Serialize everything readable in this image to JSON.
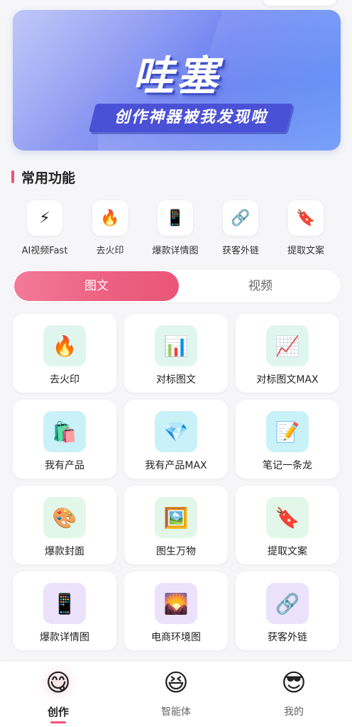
{
  "banner": {
    "title": "哇塞",
    "subtitle": "创作神器被我发现啦"
  },
  "section": {
    "title": "常用功能"
  },
  "quick_actions": [
    {
      "label": "AI视频Fast",
      "icon": "lightning-icon",
      "glyph": "⚡"
    },
    {
      "label": "去火印",
      "icon": "fire-icon",
      "glyph": "🔥"
    },
    {
      "label": "爆款详情图",
      "icon": "phone-icon",
      "glyph": "📱"
    },
    {
      "label": "获客外链",
      "icon": "link-icon",
      "glyph": "🔗"
    },
    {
      "label": "提取文案",
      "icon": "bookmark-tag-icon",
      "glyph": "🔖"
    }
  ],
  "tabs": {
    "active": "图文",
    "inactive": "视频"
  },
  "tools": [
    {
      "label": "去火印",
      "icon": "fire-icon",
      "glyph": "🔥",
      "bg": "mint"
    },
    {
      "label": "对标图文",
      "icon": "bar-chart-icon",
      "glyph": "📊",
      "bg": "mint"
    },
    {
      "label": "对标图文MAX",
      "icon": "trend-chart-icon",
      "glyph": "📈",
      "bg": "mint"
    },
    {
      "label": "我有产品",
      "icon": "shopping-bags-icon",
      "glyph": "🛍️",
      "bg": "cyan"
    },
    {
      "label": "我有产品MAX",
      "icon": "gem-icon",
      "glyph": "💎",
      "bg": "cyan"
    },
    {
      "label": "笔记一条龙",
      "icon": "memo-icon",
      "glyph": "📝",
      "bg": "cyan"
    },
    {
      "label": "爆款封面",
      "icon": "palette-icon",
      "glyph": "🎨",
      "bg": "green"
    },
    {
      "label": "图生万物",
      "icon": "framed-picture-icon",
      "glyph": "🖼️",
      "bg": "green"
    },
    {
      "label": "提取文案",
      "icon": "bookmark-tag-icon",
      "glyph": "🔖",
      "bg": "green"
    },
    {
      "label": "爆款详情图",
      "icon": "phone-icon",
      "glyph": "📱",
      "bg": "lilac"
    },
    {
      "label": "电商环境图",
      "icon": "sunrise-icon",
      "glyph": "🌄",
      "bg": "lilac"
    },
    {
      "label": "获客外链",
      "icon": "link-icon",
      "glyph": "🔗",
      "bg": "lilac"
    }
  ],
  "bottom_nav": [
    {
      "label": "创作",
      "icon": "yum-face-icon",
      "glyph": "😋",
      "active": true
    },
    {
      "label": "智能体",
      "icon": "laughing-face-icon",
      "glyph": "😆",
      "active": false
    },
    {
      "label": "我的",
      "icon": "sunglasses-face-icon",
      "glyph": "😎",
      "active": false
    }
  ],
  "colors": {
    "accent": "#ec5f80",
    "banner_blue": "#6f86f2",
    "page_bg": "#f6f6f8"
  }
}
